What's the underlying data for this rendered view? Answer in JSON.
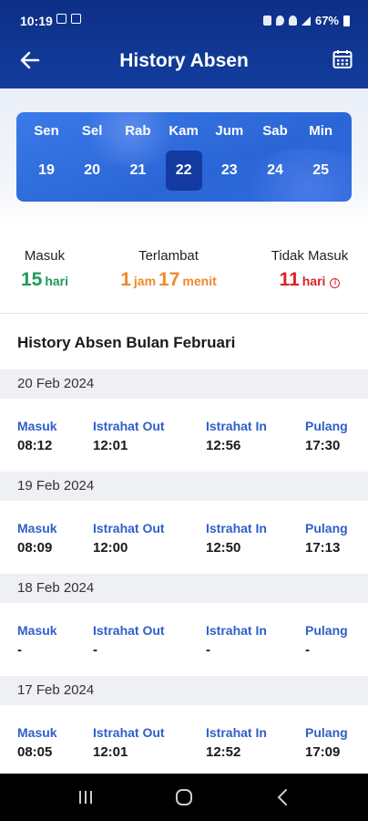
{
  "status_bar": {
    "time": "10:19",
    "battery": "67%"
  },
  "header": {
    "title": "History Absen"
  },
  "week": {
    "days": [
      {
        "name": "Sen",
        "date": "19"
      },
      {
        "name": "Sel",
        "date": "20"
      },
      {
        "name": "Rab",
        "date": "21"
      },
      {
        "name": "Kam",
        "date": "22"
      },
      {
        "name": "Jum",
        "date": "23"
      },
      {
        "name": "Sab",
        "date": "24"
      },
      {
        "name": "Min",
        "date": "25"
      }
    ],
    "selected_index": 3
  },
  "summary": {
    "masuk": {
      "label": "Masuk",
      "value": "15",
      "unit": "hari"
    },
    "terlambat": {
      "label": "Terlambat",
      "hours": "1",
      "hours_unit": "jam",
      "minutes": "17",
      "minutes_unit": "menit"
    },
    "tidak_masuk": {
      "label": "Tidak Masuk",
      "value": "11",
      "unit": "hari"
    }
  },
  "history": {
    "title": "History Absen Bulan Februari",
    "columns": [
      "Masuk",
      "Istrahat Out",
      "Istrahat In",
      "Pulang"
    ],
    "entries": [
      {
        "date": "20 Feb 2024",
        "times": [
          "08:12",
          "12:01",
          "12:56",
          "17:30"
        ]
      },
      {
        "date": "19 Feb 2024",
        "times": [
          "08:09",
          "12:00",
          "12:50",
          "17:13"
        ]
      },
      {
        "date": "18 Feb 2024",
        "times": [
          "-",
          "-",
          "-",
          "-"
        ]
      },
      {
        "date": "17 Feb 2024",
        "times": [
          "08:05",
          "12:01",
          "12:52",
          "17:09"
        ]
      }
    ]
  },
  "colors": {
    "header": "#0d2f86",
    "accent": "#2f5fc9",
    "green": "#1f9a5a",
    "orange": "#ee8a2b",
    "red": "#d9232a"
  }
}
